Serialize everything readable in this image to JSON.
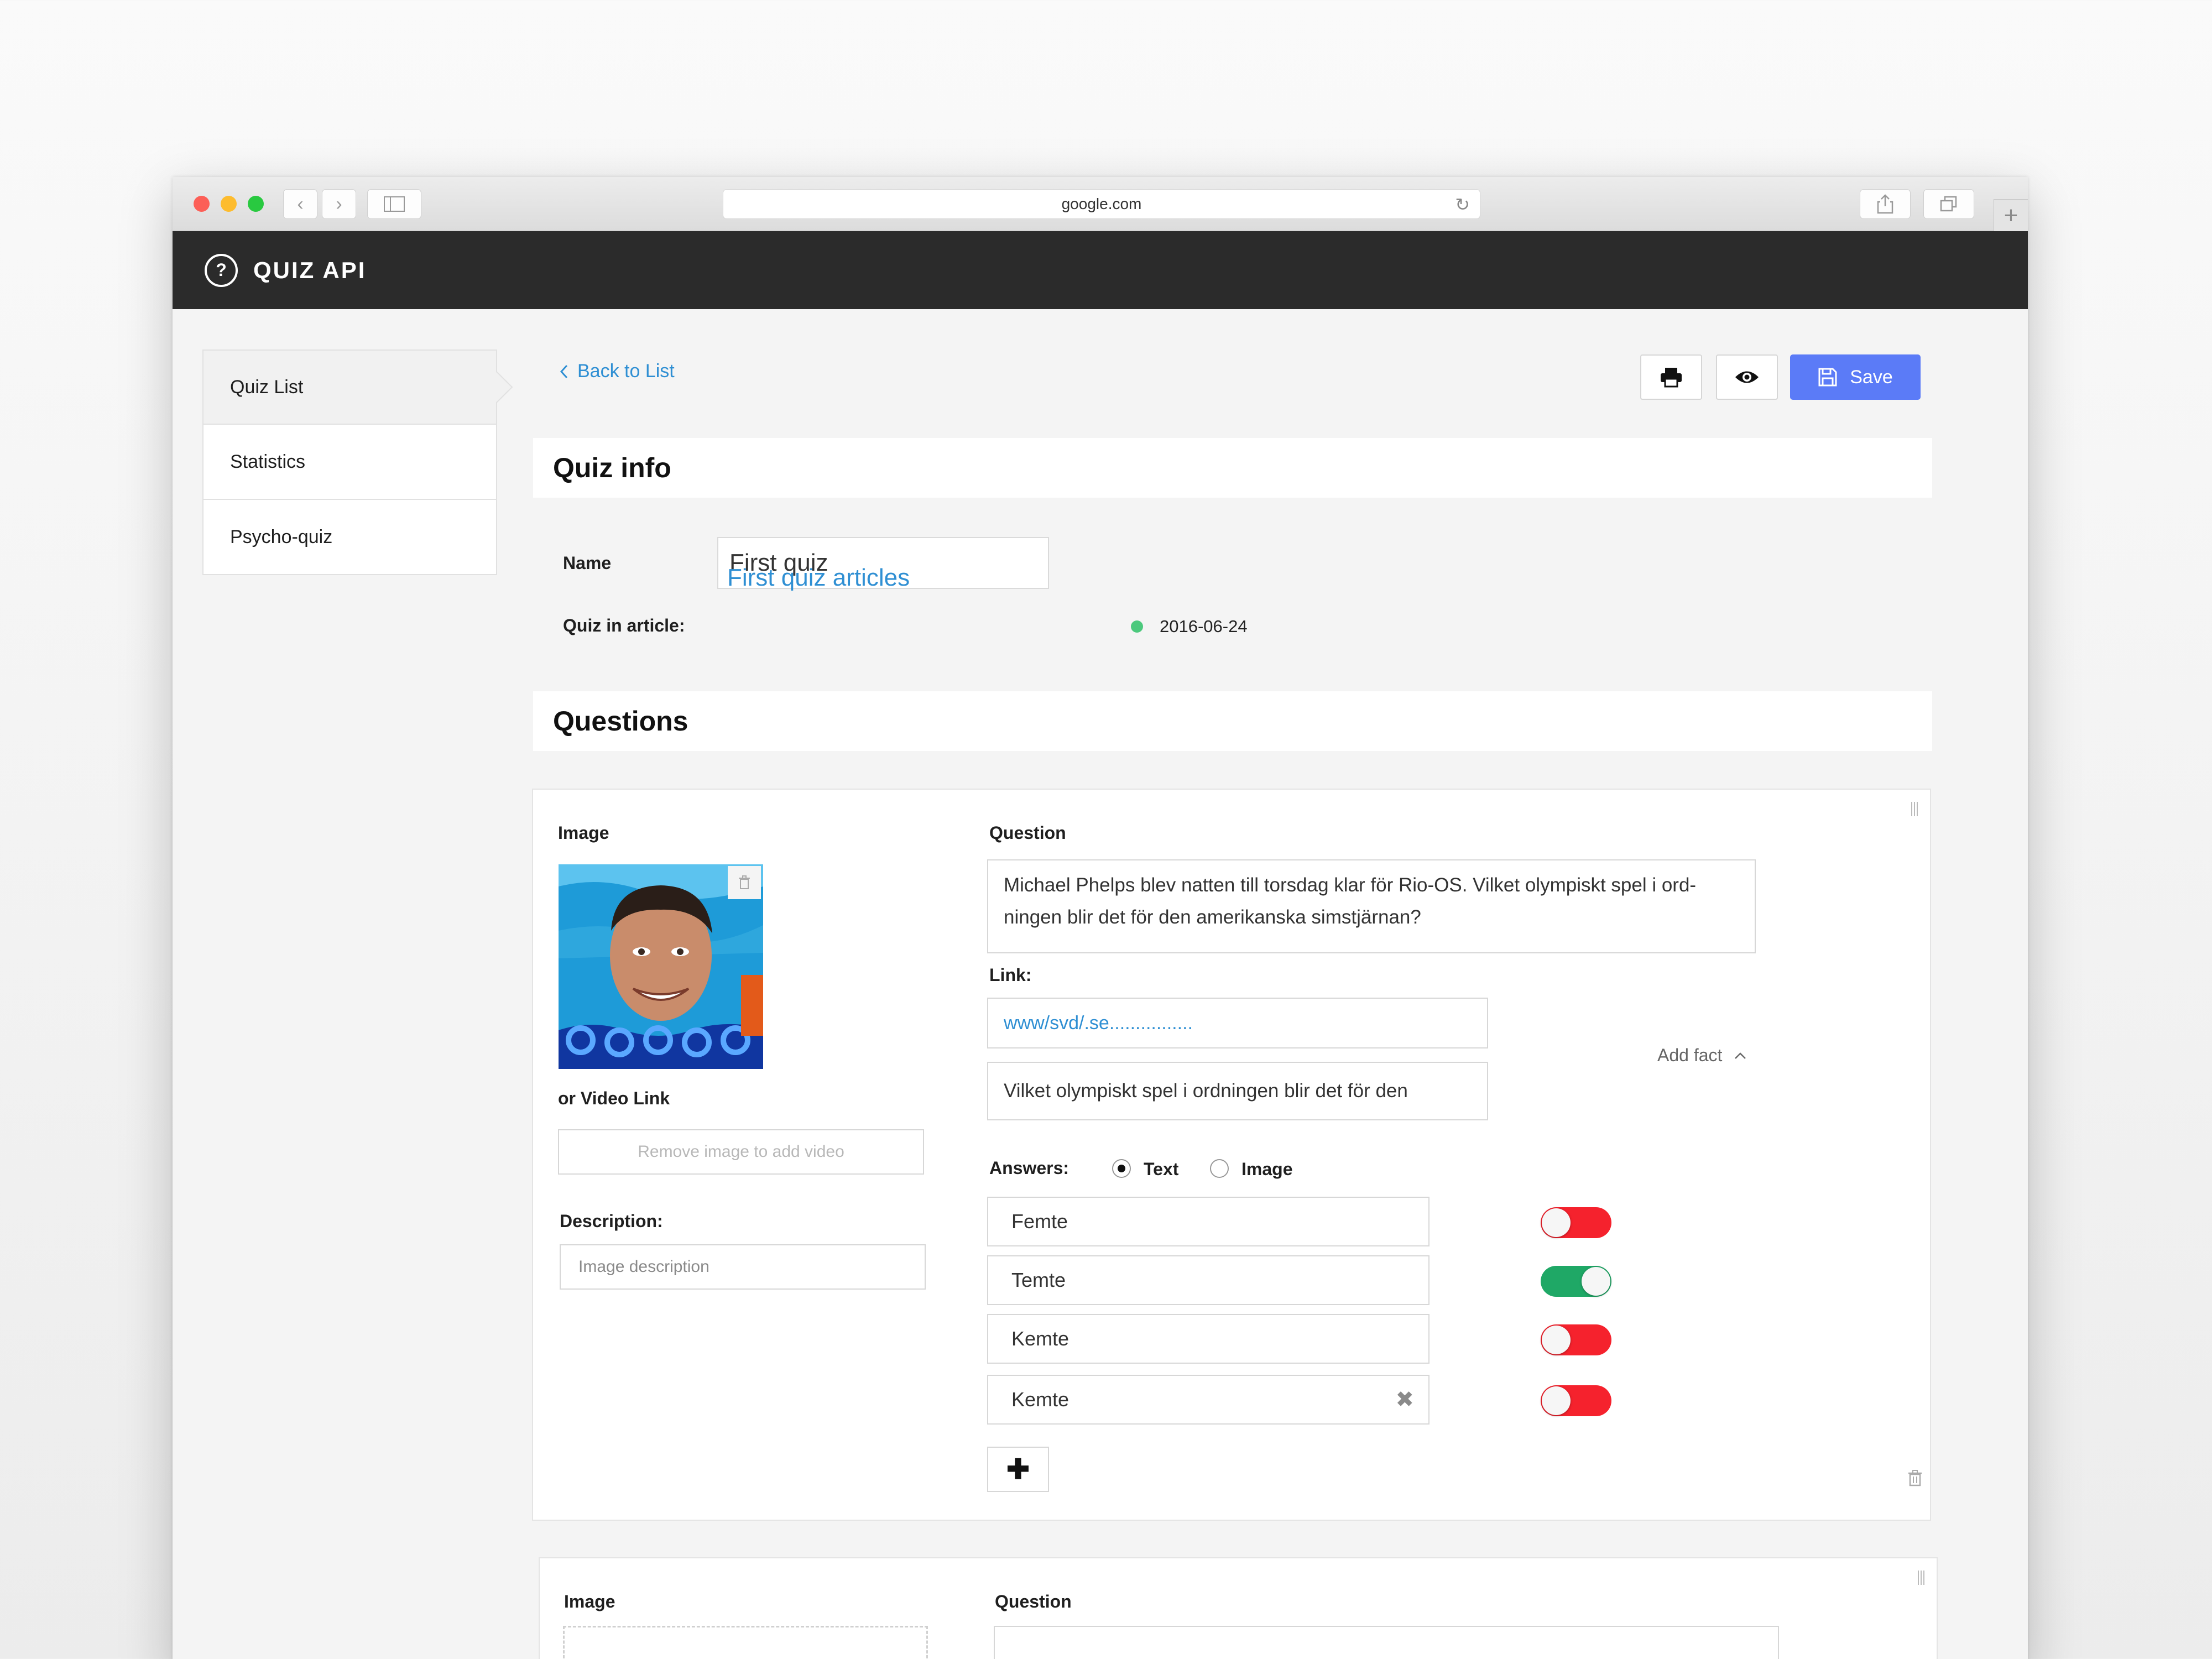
{
  "browser": {
    "url": "google.com"
  },
  "app": {
    "title": "QUIZ API"
  },
  "sidebar": {
    "items": [
      {
        "label": "Quiz List"
      },
      {
        "label": "Statistics"
      },
      {
        "label": "Psycho-quiz"
      }
    ]
  },
  "toolbar": {
    "back_label": "Back to List",
    "save_label": "Save"
  },
  "quiz_info": {
    "title": "Quiz info",
    "name_label": "Name",
    "name_value": "First quiz",
    "article_label": "Quiz in article:",
    "article_link": "First quiz articles",
    "status_color": "#4cc97d",
    "date": "2016-06-24"
  },
  "questions": {
    "title": "Questions",
    "items": [
      {
        "image_label": "Image",
        "video_label": "or Video Link",
        "video_placeholder": "Remove image to add video",
        "description_label": "Description:",
        "description_placeholder": "Image description",
        "question_label": "Question",
        "question_text": "Michael Phelps blev natten till torsdag klar för Rio-OS. Vilket olympiskt spel i ord-ningen blir det för den amerikanska simstjärnan?",
        "link_label": "Link:",
        "link_value": "www/svd/.se................",
        "fact_value": "Vilket olympiskt spel i ordningen blir det för den",
        "add_fact_label": "Add fact",
        "answers_label": "Answers:",
        "answer_type_options": [
          {
            "label": "Text",
            "selected": true
          },
          {
            "label": "Image",
            "selected": false
          }
        ],
        "answers": [
          {
            "text": "Femte",
            "correct": false
          },
          {
            "text": "Temte",
            "correct": true
          },
          {
            "text": "Kemte",
            "correct": false
          },
          {
            "text": "Kemte",
            "correct": false
          }
        ]
      },
      {
        "image_label": "Image",
        "question_label": "Question"
      }
    ]
  },
  "colors": {
    "accent": "#5b7bf7",
    "link": "#2f8fd3",
    "toggle_on": "#1fa866",
    "toggle_off": "#f5222d",
    "header_bg": "#2b2b2b"
  }
}
